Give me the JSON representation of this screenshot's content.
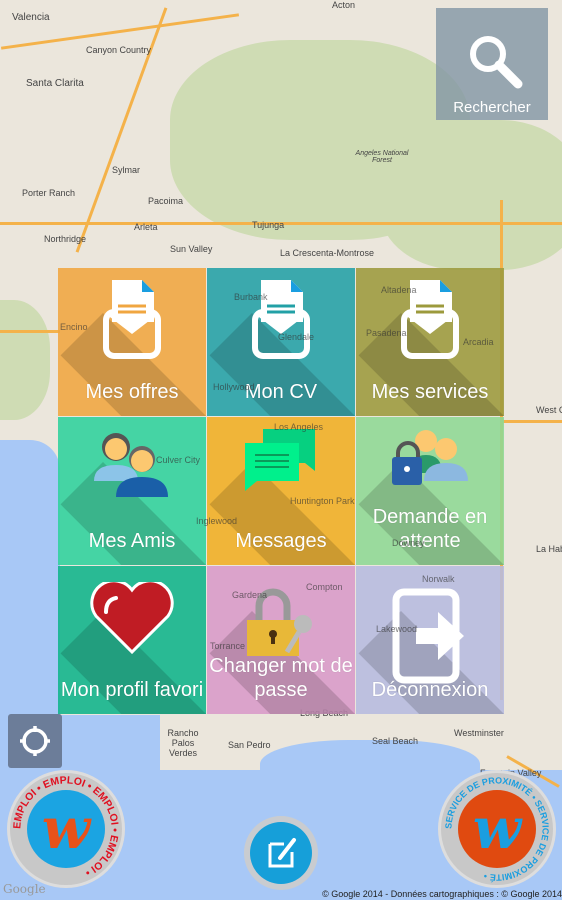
{
  "map": {
    "labels": [
      "Acton",
      "Valencia",
      "Canyon Country",
      "Santa Clarita",
      "Angeles National Forest",
      "Sylmar",
      "Porter Ranch",
      "Pacoima",
      "Northridge",
      "Arleta",
      "Tujunga",
      "Sun Valley",
      "La Crescenta-Montrose",
      "Encino",
      "Burbank",
      "Glendale",
      "Pasadena",
      "Altadena",
      "Arcadia",
      "Hollywood",
      "West Covina",
      "Los Angeles",
      "Culver City",
      "Inglewood",
      "Huntington Park",
      "Downey",
      "Gardena",
      "Compton",
      "Torrance",
      "Norwalk",
      "Lakewood",
      "La Habra",
      "Long Beach",
      "Rancho Palos Verdes",
      "San Pedro",
      "Seal Beach",
      "Westminster",
      "Fountain Valley"
    ],
    "attribution": "© Google 2014 - Données cartographiques : © Google 2014",
    "google_logo": "Google"
  },
  "search": {
    "label": "Rechercher",
    "icon": "search-icon"
  },
  "tiles": [
    {
      "label": "Mes offres",
      "color": "#f0a640",
      "icon": "envelope-document-icon"
    },
    {
      "label": "Mon CV",
      "color": "#22a0a6",
      "icon": "envelope-document-icon"
    },
    {
      "label": "Mes services",
      "color": "#9c9a3c",
      "icon": "envelope-document-icon"
    },
    {
      "label": "Mes Amis",
      "color": "#2ed19c",
      "icon": "friends-icon"
    },
    {
      "label": "Messages",
      "color": "#f0ae22",
      "icon": "chat-bubbles-icon"
    },
    {
      "label": "Demande en attente",
      "color": "#8ed894",
      "icon": "locked-users-icon"
    },
    {
      "label": "Mon profil favori",
      "color": "#0eb48a",
      "icon": "heart-icon"
    },
    {
      "label": "Changer mot de passe",
      "color": "#d89ac8",
      "icon": "padlock-key-icon"
    },
    {
      "label": "Déconnexion",
      "color": "#b6bbdf",
      "icon": "logout-icon"
    }
  ],
  "badges": {
    "left": {
      "ring_text": "EMPLOI • EMPLOI • EMPLOI • EMPLOI •",
      "letter": "w"
    },
    "right": {
      "ring_text": "SERVICE DE PROXIMITÉ • SERVICE DE PROXIMITÉ •",
      "letter": "w"
    }
  }
}
